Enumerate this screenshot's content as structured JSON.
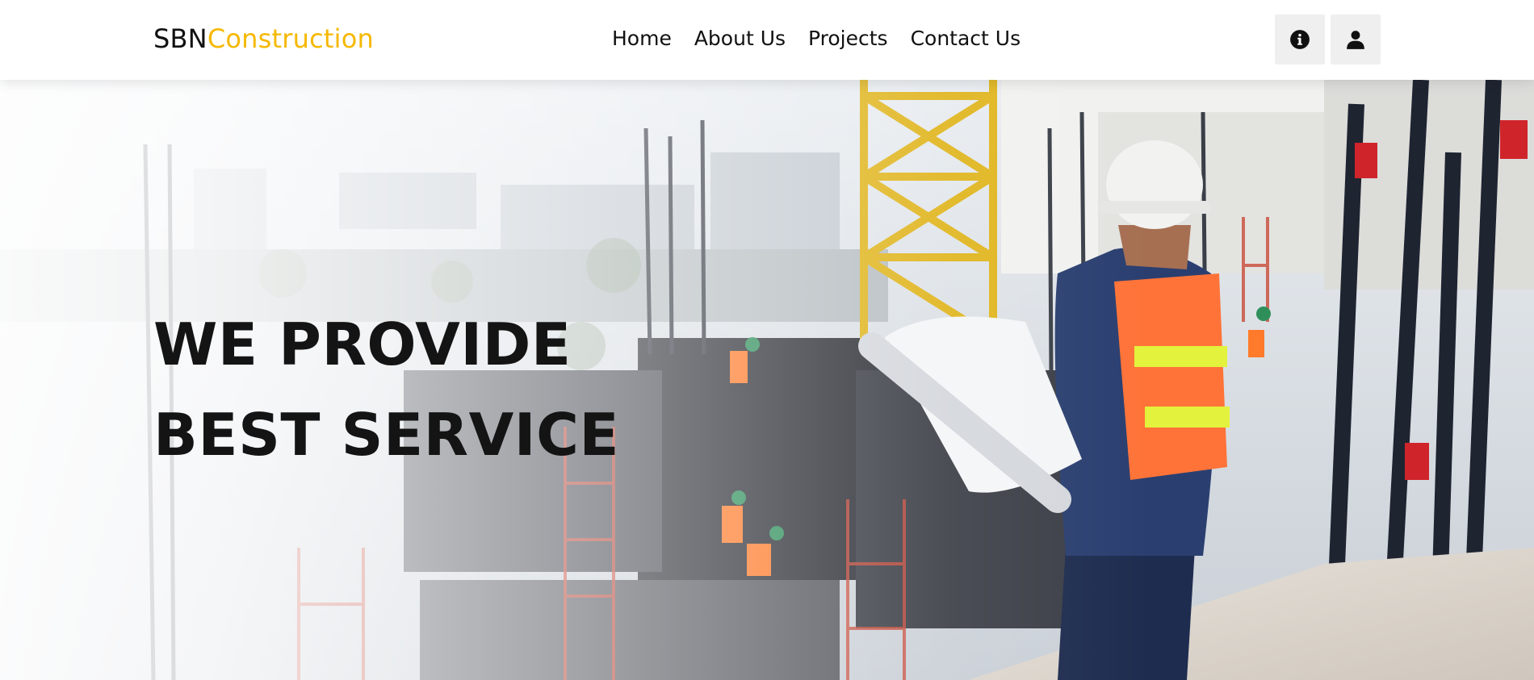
{
  "nav": {
    "brand_primary": "SBN",
    "brand_accent": "Construction",
    "links": [
      {
        "label": "Home"
      },
      {
        "label": "About Us"
      },
      {
        "label": "Projects"
      },
      {
        "label": "Contact Us"
      }
    ],
    "info_icon": "info-circle-icon",
    "user_icon": "user-icon"
  },
  "hero": {
    "line1": "WE PROVIDE",
    "line2": "BEST SERVICE",
    "image_subject": "construction-site-worker-photo"
  },
  "colors": {
    "accent": "#f5b800",
    "nav_bg": "#ffffff",
    "icon_button_bg": "#efefef",
    "text": "#141414"
  }
}
